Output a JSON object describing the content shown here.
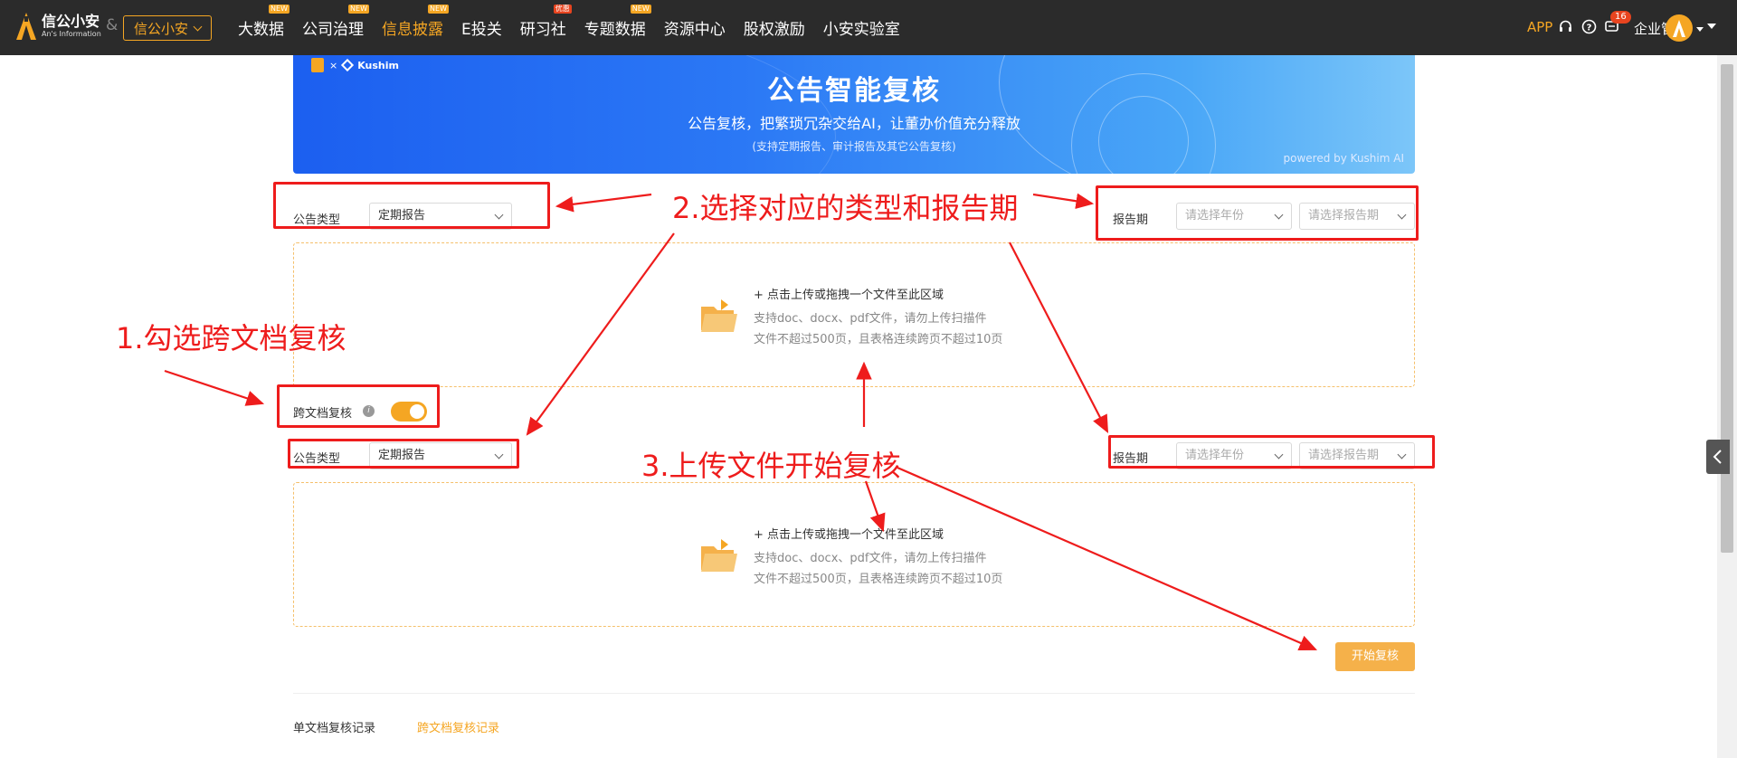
{
  "header": {
    "logo_title": "信公小安",
    "logo_subtitle": "An's Information",
    "amp": "&",
    "brand_button": "信公小安",
    "nav": [
      {
        "label": "大数据",
        "tag": "NEW",
        "tag_color": "orange",
        "active": false
      },
      {
        "label": "公司治理",
        "tag": "NEW",
        "tag_color": "orange",
        "active": false
      },
      {
        "label": "信息披露",
        "tag": "NEW",
        "tag_color": "orange",
        "active": true
      },
      {
        "label": "E投关",
        "tag": "",
        "active": false
      },
      {
        "label": "研习社",
        "tag": "优惠",
        "tag_color": "red",
        "active": false
      },
      {
        "label": "专题数据",
        "tag": "NEW",
        "tag_color": "orange",
        "active": false
      },
      {
        "label": "资源中心",
        "tag": "",
        "active": false
      },
      {
        "label": "股权激励",
        "tag": "",
        "active": false
      },
      {
        "label": "小安实验室",
        "tag": "",
        "active": false
      }
    ],
    "app_link": "APP",
    "notification_count": "16",
    "enterprise_menu": "企业管理",
    "icons": [
      "headset-icon",
      "help-icon",
      "message-icon",
      "avatar",
      "chevron-down-icon"
    ]
  },
  "banner": {
    "partner_x": "×",
    "partner_name": "Kushim",
    "title": "公告智能复核",
    "subtitle": "公告复核，把繁琐冗杂交给AI，让董办价值充分释放",
    "note": "(支持定期报告、审计报告及其它公告复核)",
    "powered_by": "powered by Kushim AI"
  },
  "form1": {
    "type_label": "公告类型",
    "type_value": "定期报告",
    "period_label": "报告期",
    "year_placeholder": "请选择年份",
    "period_placeholder": "请选择报告期"
  },
  "upload": {
    "title": "+ 点击上传或拖拽一个文件至此区域",
    "line1": "支持doc、docx、pdf文件，请勿上传扫描件",
    "line2": "文件不超过500页，且表格连续跨页不超过10页"
  },
  "cross_doc": {
    "label": "跨文档复核",
    "info": "i",
    "enabled": true
  },
  "form2": {
    "type_label": "公告类型",
    "type_value": "定期报告",
    "period_label": "报告期",
    "year_placeholder": "请选择年份",
    "period_placeholder": "请选择报告期"
  },
  "start_button": "开始复核",
  "tabs": {
    "single": "单文档复核记录",
    "cross": "跨文档复核记录"
  },
  "annotations": {
    "step1": "1.勾选跨文档复核",
    "step2": "2.选择对应的类型和报告期",
    "step3": "3.上传文件开始复核"
  },
  "colors": {
    "accent": "#f5a623",
    "annotation": "#ee1c1c",
    "topbar": "#2b2b2b",
    "banner": "#2b78f5"
  }
}
